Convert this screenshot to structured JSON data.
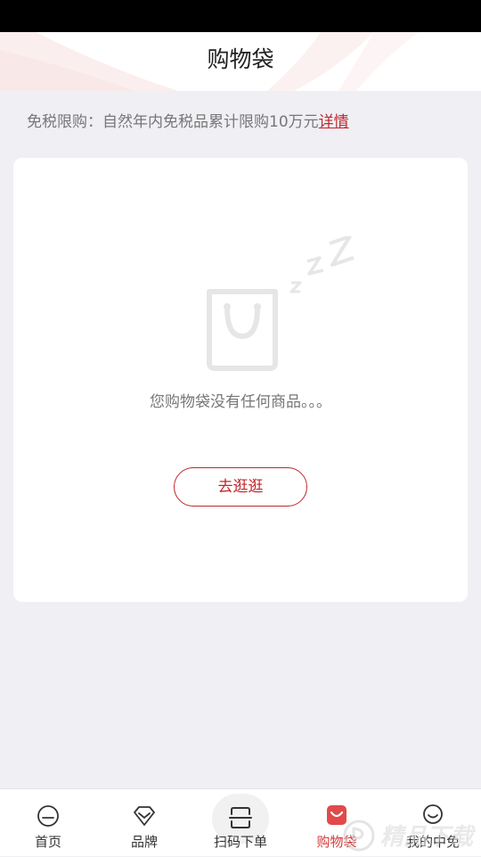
{
  "header": {
    "title": "购物袋"
  },
  "notice": {
    "text": "免税限购：自然年内免税品累计限购10万元",
    "link_label": "详情"
  },
  "empty_state": {
    "message": "您购物袋没有任何商品。。。",
    "button_label": "去逛逛",
    "icon": "sleeping-bag-icon"
  },
  "tabbar": {
    "items": [
      {
        "label": "首页",
        "icon": "home-icon",
        "active": false
      },
      {
        "label": "品牌",
        "icon": "diamond-icon",
        "active": false
      },
      {
        "label": "扫码下单",
        "icon": "scan-icon",
        "active": false
      },
      {
        "label": "购物袋",
        "icon": "shopping-bag-icon",
        "active": true
      },
      {
        "label": "我的中免",
        "icon": "profile-icon",
        "active": false
      }
    ]
  },
  "colors": {
    "accent": "#c0272d",
    "active_tab": "#d23a3a",
    "background": "#f0eff4"
  },
  "watermark": {
    "text": "精品下载"
  }
}
